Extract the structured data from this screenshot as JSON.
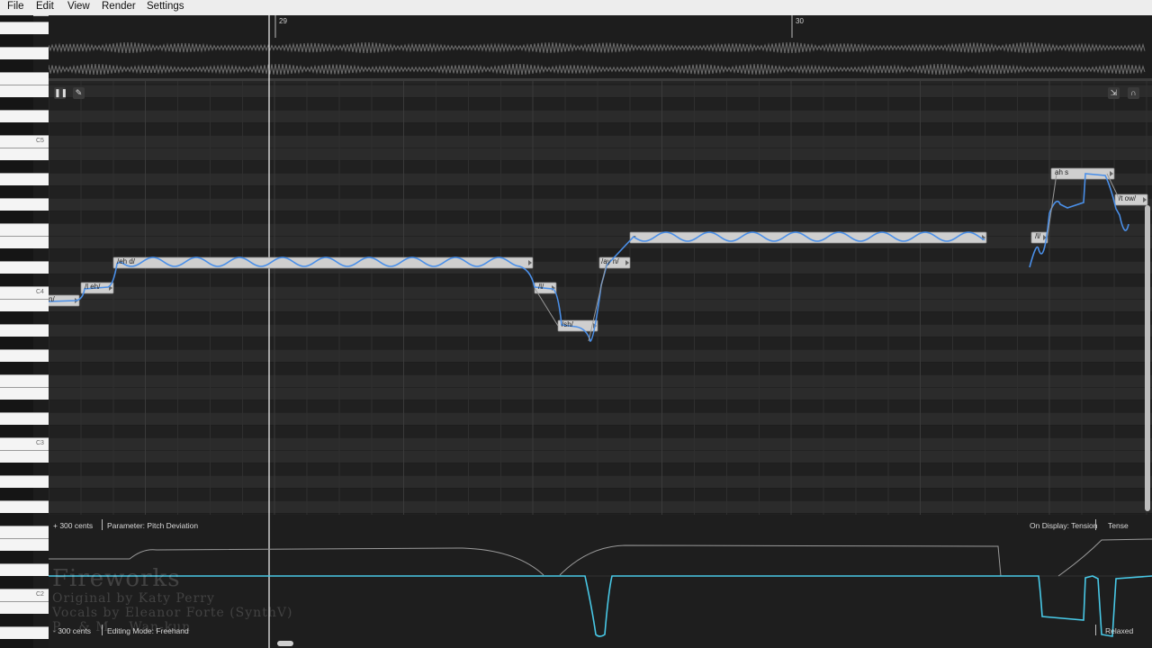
{
  "menu": [
    "File",
    "Edit",
    "View",
    "Render",
    "Settings"
  ],
  "ruler": {
    "marks": [
      "29",
      "30"
    ]
  },
  "octave_labels": [
    "C5",
    "C4",
    "C3",
    "C2"
  ],
  "notes": [
    {
      "lyric": "n/"
    },
    {
      "lyric": "/l eh/"
    },
    {
      "lyric": "/eh d/"
    },
    {
      "lyric": "/l/"
    },
    {
      "lyric": "/sh/"
    },
    {
      "lyric": "/ay n/"
    },
    {
      "lyric": "-"
    },
    {
      "lyric": "/l/"
    },
    {
      "lyric": "ah s"
    },
    {
      "lyric": "/t ow/"
    }
  ],
  "toolbar": {
    "left_buttons": [
      "pause-icon",
      "pencil-icon"
    ],
    "right_buttons": [
      "collapse-icon",
      "arch-icon"
    ]
  },
  "param_panel": {
    "top_range": "+ 300 cents",
    "parameter": "Parameter: Pitch Deviation",
    "on_display": "On Display: Tension",
    "tense": "Tense",
    "bottom_range": "- 300 cents",
    "editing_mode": "Editing Mode: Freehand",
    "relaxed": "Relaxed"
  },
  "credits": {
    "title": "Fireworks",
    "original": "Original by Katy Perry",
    "vocals": "Vocals by Eleanor Forte (SynthV)",
    "tuning": "P... & M... Wan-kun"
  },
  "colors": {
    "pitch_curve": "#4a8fe8",
    "param_curve": "#48c8e6",
    "note_fill": "#cfcfcf"
  }
}
